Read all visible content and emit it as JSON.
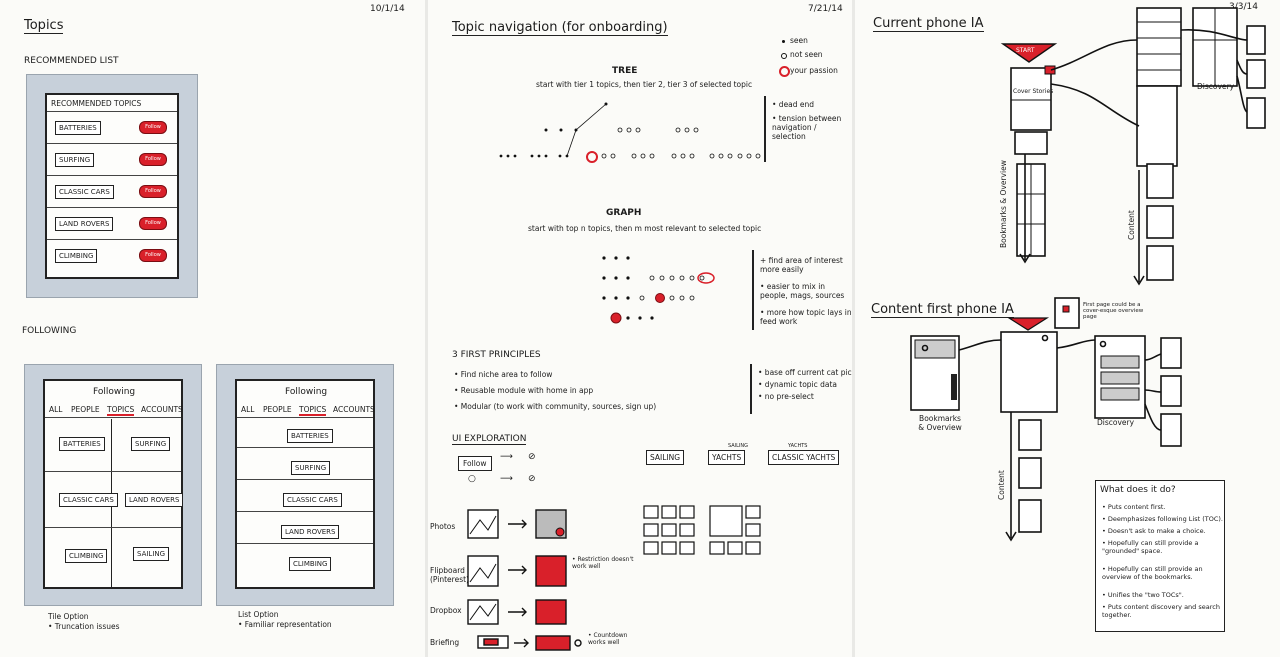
{
  "left": {
    "date": "10/1/14",
    "title": "Topics",
    "recommended_heading": "RECOMMENDED LIST",
    "recommended_topics_label": "RECOMMENDED TOPICS",
    "follow_label": "Follow",
    "topics": [
      "BATTERIES",
      "SURFING",
      "CLASSIC CARS",
      "LAND ROVERS",
      "CLIMBING"
    ],
    "following_heading": "FOLLOWING",
    "screen_title": "Following",
    "tabs": [
      "ALL",
      "PEOPLE",
      "TOPICS",
      "ACCOUNTS"
    ],
    "tile_topics": [
      "BATTERIES",
      "SURFING",
      "CLASSIC CARS",
      "LAND ROVERS",
      "CLIMBING",
      "SAILING"
    ],
    "list_topics": [
      "BATTERIES",
      "SURFING",
      "CLASSIC CARS",
      "LAND ROVERS",
      "CLIMBING"
    ],
    "tile_caption": "Tile Option",
    "tile_note": "• Truncation issues",
    "list_caption": "List Option",
    "list_note": "• Familiar representation"
  },
  "middle": {
    "date": "7/21/14",
    "title": "Topic navigation (for onboarding)",
    "legend": [
      "seen",
      "not seen",
      "your passion"
    ],
    "tree_heading": "TREE",
    "tree_desc": "start with tier 1 topics, then tier 2, tier 3 of selected topic",
    "tree_notes": [
      "• dead end",
      "• tension between navigation / selection"
    ],
    "graph_heading": "GRAPH",
    "graph_desc": "start with top n topics, then m most relevant to selected topic",
    "graph_notes": [
      "+ find area of interest more easily",
      "• easier to mix in people, mags, sources",
      "• more how topic lays in feed work"
    ],
    "principles_heading": "3 FIRST PRINCIPLES",
    "principles": [
      "• Find niche area to follow",
      "• Reusable module with home in app",
      "• Modular (to work with community, sources, sign up)"
    ],
    "principles_notes": [
      "• base off current cat picker",
      "• dynamic topic data",
      "• no pre-select"
    ],
    "ui_heading": "UI EXPLORATION",
    "follow_button": "Follow",
    "chips": [
      "SAILING",
      "YACHTS",
      "CLASSIC YACHTS"
    ],
    "chip_small": [
      "SAILING",
      "YACHTS"
    ],
    "rows": [
      "Photos",
      "Flipboard (Pinterest)",
      "Dropbox",
      "Briefing"
    ],
    "row_notes": [
      "• Restriction doesn't work well",
      "• Countdown works well"
    ]
  },
  "right": {
    "date": "3/3/14",
    "title1": "Current phone IA",
    "start_label": "START",
    "cover_stories": "Cover Stories",
    "discovery": "Discovery",
    "bookmarks_overview": "Bookmarks & Overview",
    "content": "Content",
    "title2": "Content first phone IA",
    "note_tag": "First page could be a cover-esque overview page",
    "bookmarks_caption": "Bookmarks & Overview",
    "discovery2": "Discovery",
    "content2": "Content",
    "what_heading": "What does it do?",
    "what_items": [
      "• Puts content first.",
      "• Deemphasizes following List (TOC).",
      "• Doesn't ask to make a choice.",
      "• Hopefully can still provide a \"grounded\" space.",
      "• Hopefully can still provide an overview of the bookmarks.",
      "• Unifies the \"two TOCs\".",
      "• Puts content discovery and search together."
    ]
  },
  "accent": "#d9202a"
}
